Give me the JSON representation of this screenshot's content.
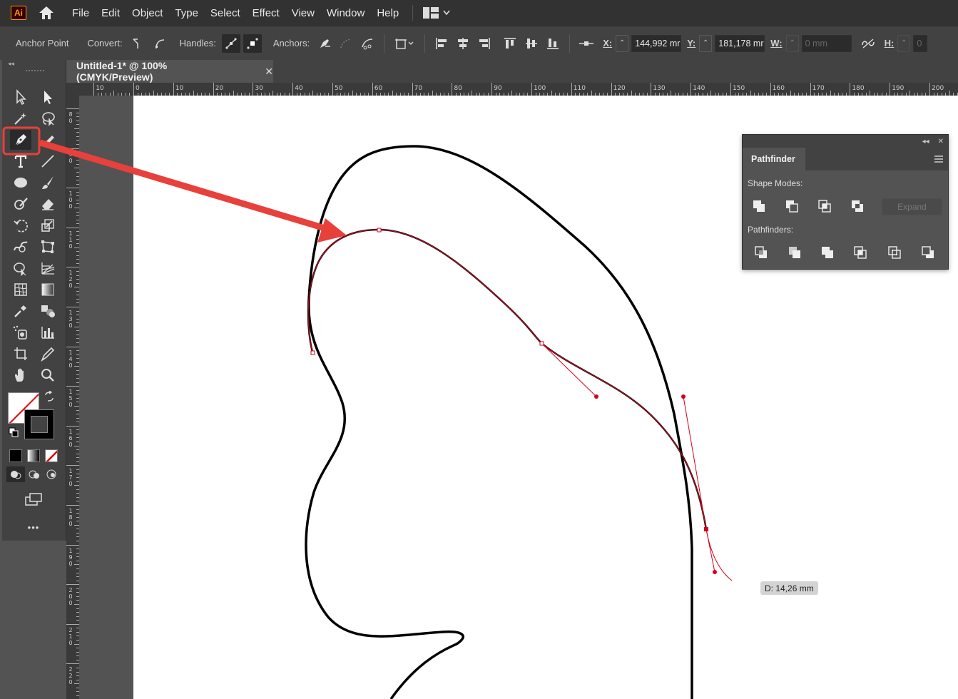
{
  "app": {
    "logo_text": "Ai"
  },
  "menu": {
    "items": [
      "File",
      "Edit",
      "Object",
      "Type",
      "Select",
      "Effect",
      "View",
      "Window",
      "Help"
    ]
  },
  "control_bar": {
    "context_label": "Anchor Point",
    "convert_label": "Convert:",
    "handles_label": "Handles:",
    "anchors_label": "Anchors:",
    "x_label": "X:",
    "x_value": "144,992 mr",
    "y_label": "Y:",
    "y_value": "181,178 mr",
    "w_label": "W:",
    "w_value": "0 mm",
    "h_label": "H:",
    "h_value": "0"
  },
  "document": {
    "tab_title": "Untitled-1* @ 100% (CMYK/Preview)",
    "close_glyph": "✕"
  },
  "rulers": {
    "horizontal": [
      "10",
      "0",
      "10",
      "20",
      "30",
      "40",
      "50",
      "60",
      "70",
      "80",
      "90",
      "100",
      "110",
      "120",
      "130",
      "140",
      "150",
      "160",
      "170",
      "180",
      "190",
      "200"
    ],
    "vertical": [
      "80",
      "90",
      "100",
      "110",
      "120",
      "130",
      "140",
      "150",
      "160",
      "170",
      "180",
      "190",
      "200",
      "210",
      "220"
    ]
  },
  "toolbar": {
    "selected_tool": "pen-tool",
    "more_tools_glyph": "•••"
  },
  "pathfinder_panel": {
    "title": "Pathfinder",
    "shape_modes_label": "Shape Modes:",
    "pathfinders_label": "Pathfinders:",
    "expand_label": "Expand",
    "collapse_glyph": "◂◂",
    "close_glyph": "✕"
  },
  "canvas": {
    "distance_tooltip": "D: 14,26 mm"
  },
  "colors": {
    "highlight": "#e8403a",
    "path_selected": "#d0021b",
    "menubar_bg": "#323232",
    "panel_bg": "#535353"
  }
}
